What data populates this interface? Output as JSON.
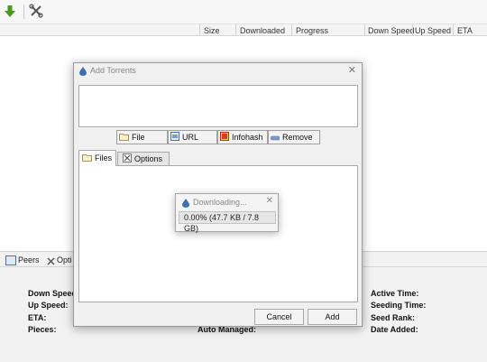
{
  "toolbar": {
    "icons": [
      "download-arrow-icon",
      "preferences-icon"
    ]
  },
  "columns": [
    "Size",
    "Downloaded",
    "Progress",
    "Down Speed",
    "Up Speed",
    "ETA"
  ],
  "bottom_tabs": {
    "peers": "Peers",
    "options": "Opti"
  },
  "details": {
    "left": [
      "Down Speed",
      "Up Speed:",
      "ETA:",
      "Pieces:"
    ],
    "middle": [
      "Auto Managed:"
    ],
    "right": [
      "Active Time:",
      "Seeding Time:",
      "Seed Rank:",
      "Date Added:"
    ]
  },
  "add_dialog": {
    "title": "Add Torrents",
    "buttons": {
      "file": "File",
      "url": "URL",
      "infohash": "Infohash",
      "remove": "Remove"
    },
    "tabs": {
      "files": "Files",
      "options": "Options"
    },
    "cancel": "Cancel",
    "add": "Add"
  },
  "download_popup": {
    "title": "Downloading...",
    "progress_text": "0.00% (47.7 KB / 7.8 GB)"
  },
  "colors": {
    "accent_green": "#4a9a1e",
    "deluge_blue": "#3c6fb0",
    "dialog_bg": "#f0f0f0"
  }
}
